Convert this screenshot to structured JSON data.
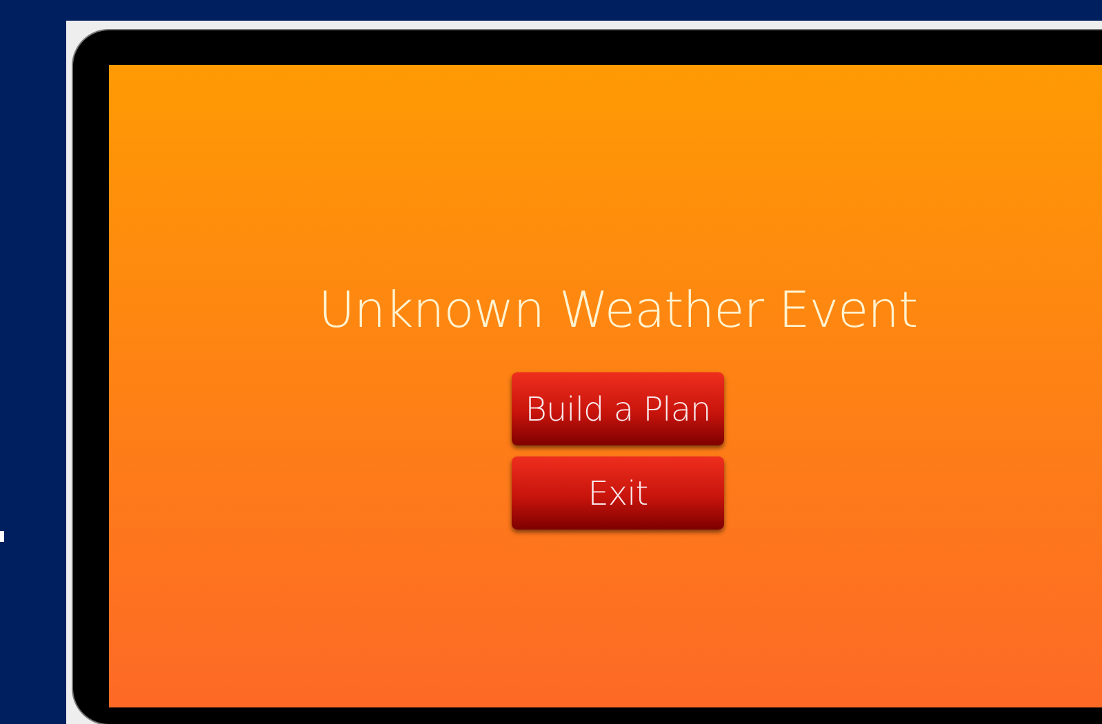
{
  "screen": {
    "title": "Unknown Weather Event",
    "buttons": [
      {
        "label": "Build a Plan"
      },
      {
        "label": "Exit"
      }
    ]
  }
}
